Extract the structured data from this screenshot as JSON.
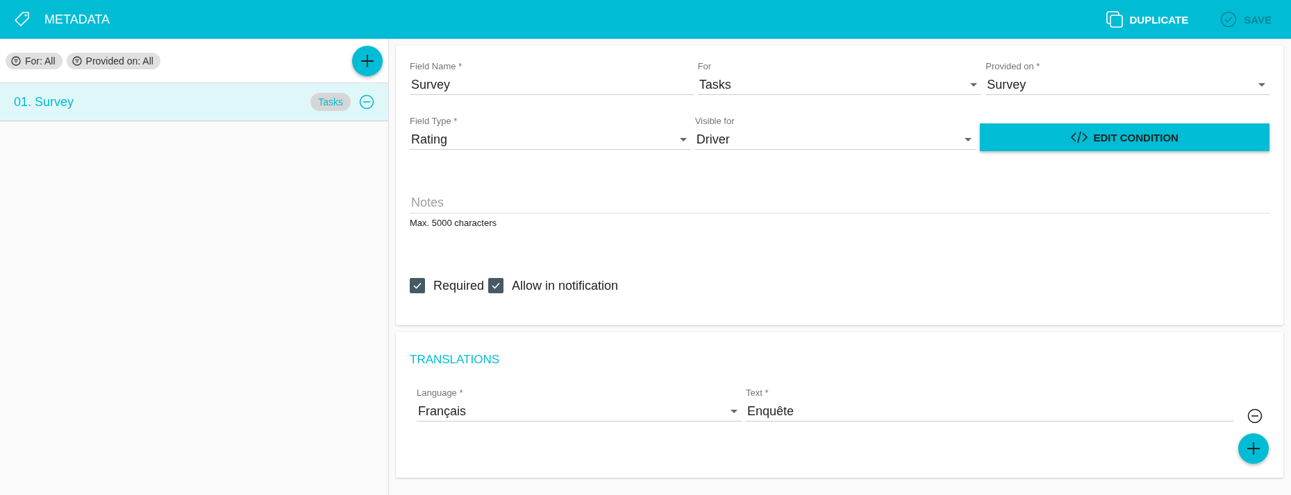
{
  "header": {
    "title": "METADATA",
    "actions": [
      {
        "label": "DUPLICATE",
        "kind": "copy",
        "disabled": false
      },
      {
        "label": "SAVE",
        "kind": "check",
        "disabled": true
      }
    ]
  },
  "sidebar": {
    "filters": [
      "For: All",
      "Provided on: All"
    ],
    "items": [
      {
        "label": "01. Survey",
        "tag": "Tasks",
        "selected": true
      }
    ]
  },
  "form": {
    "rows": [
      [
        {
          "kind": "text",
          "label": "Field Name *",
          "value": "Survey"
        },
        {
          "kind": "select",
          "label": "For",
          "value": "Tasks"
        },
        {
          "kind": "select",
          "label": "Provided on *",
          "value": "Survey"
        }
      ],
      [
        {
          "kind": "select",
          "label": "Field Type *",
          "value": "Rating"
        },
        {
          "kind": "select",
          "label": "Visible for",
          "value": "Driver"
        },
        {
          "kind": "button",
          "label": "EDIT CONDITION"
        }
      ]
    ],
    "notes": {
      "placeholder": "Notes",
      "helper": "Max. 5000 characters"
    },
    "checkboxes": [
      {
        "label": "Required",
        "checked": true
      },
      {
        "label": "Allow in notification",
        "checked": true
      }
    ]
  },
  "translations": {
    "title": "TRANSLATIONS",
    "rows": [
      {
        "language_label": "Language *",
        "language": "Français",
        "text_label": "Text *",
        "text": "Enquête"
      }
    ]
  }
}
